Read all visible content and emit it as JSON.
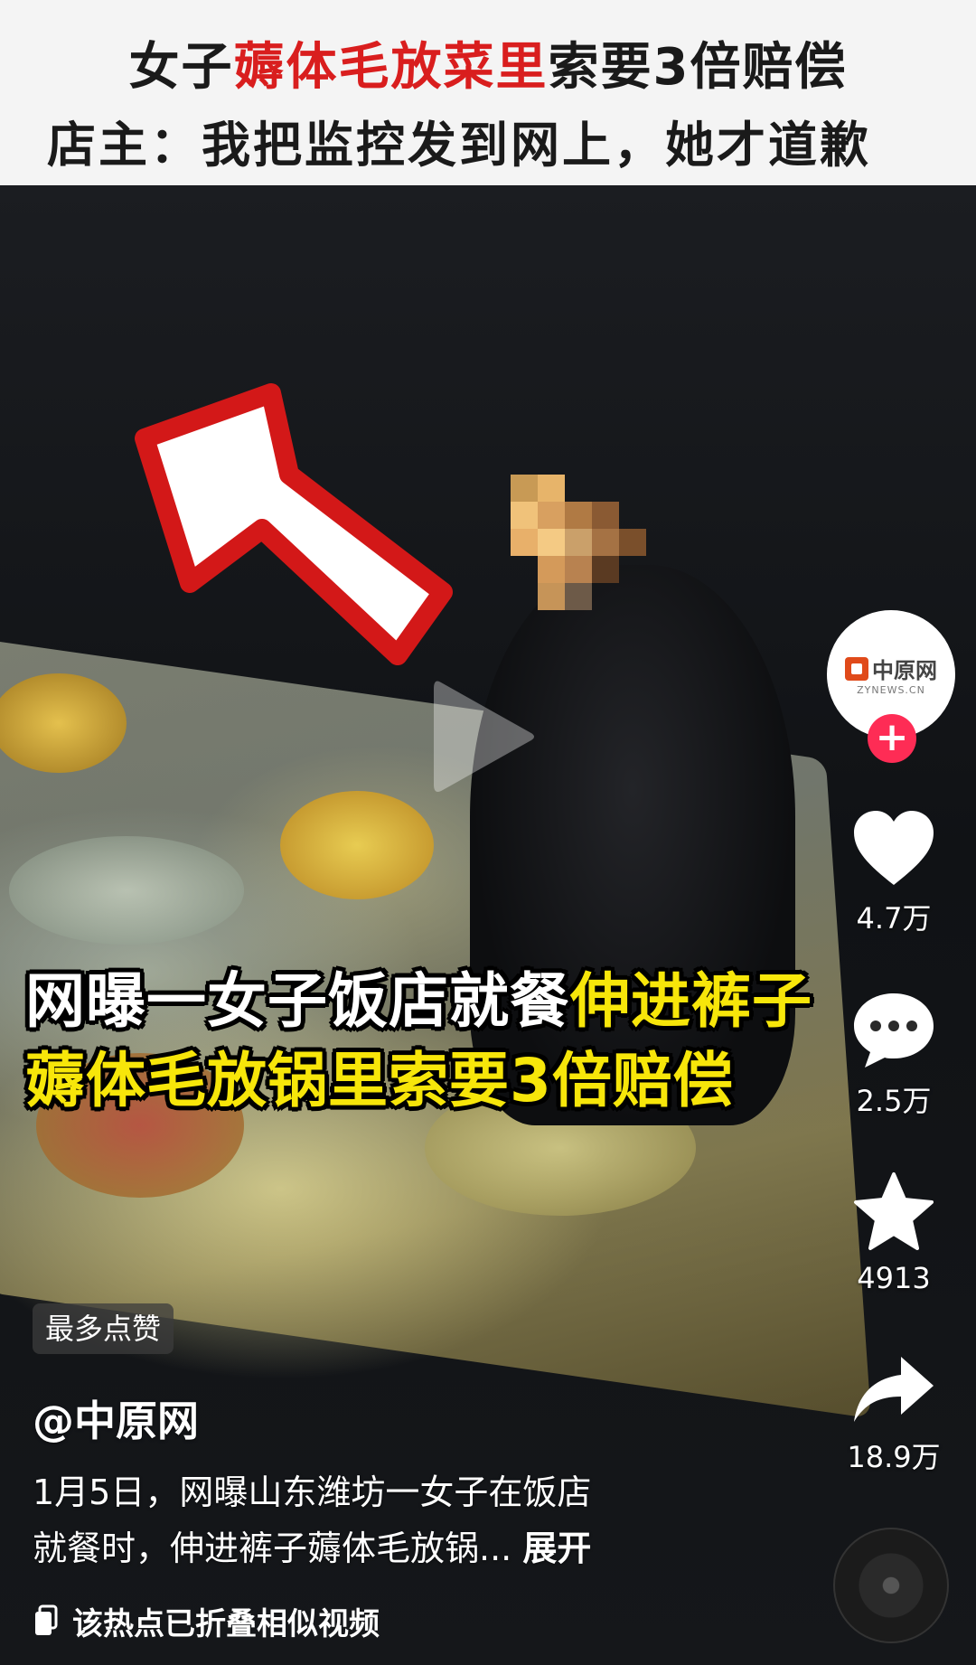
{
  "title": {
    "line1_pre": "女子",
    "line1_highlight": "薅体毛放菜里",
    "line1_post": "索要3倍赔偿",
    "line2": "店主：我把监控发到网上，她才道歉"
  },
  "video_caption": {
    "line1_white": "网曝一女子饭店就餐",
    "line1_yellow": "伸进裤子",
    "line2": "薅体毛放锅里索要3倍赔偿"
  },
  "creator": {
    "avatar_name": "中原网",
    "avatar_sub": "ZYNEWS.CN",
    "follow_symbol": "+"
  },
  "actions": {
    "likes": "4.7万",
    "comments": "2.5万",
    "favorites": "4913",
    "shares": "18.9万"
  },
  "post": {
    "badge": "最多点赞",
    "author": "@中原网",
    "desc_line1": "1月5日，网曝山东潍坊一女子在饭店",
    "desc_line2": "就餐时，伸进裤子薅体毛放锅...",
    "expand": "展开",
    "fold_notice": "该热点已折叠相似视频"
  },
  "colors": {
    "highlight_red": "#d91e1e",
    "caption_yellow": "#f7e60a",
    "follow_pink": "#fe2c55",
    "logo_orange": "#e04a1a"
  },
  "icons": [
    "heart-icon",
    "comment-icon",
    "star-icon",
    "share-icon",
    "play-icon",
    "arrow-annotation-icon",
    "fold-icon",
    "music-disc-icon"
  ]
}
